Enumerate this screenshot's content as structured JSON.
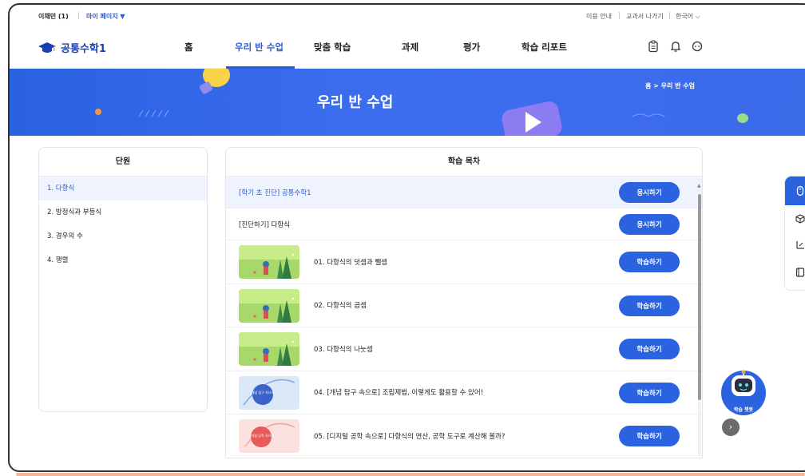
{
  "topbar": {
    "user": "이채민 (1)",
    "mypage": "마이 페이지 ▼",
    "guide": "이용 안내",
    "textbook_exit": "교과서 나가기",
    "language": "한국어 ⌵"
  },
  "nav": {
    "logo_text": "공통수학1",
    "items": [
      "홈",
      "우리 반 수업",
      "맞춤 학습",
      "과제",
      "평가",
      "학습 리포트"
    ],
    "active_index": 1
  },
  "hero": {
    "title": "우리 반 수업",
    "breadcrumb": "홈 > 우리 반 수업"
  },
  "units": {
    "header": "단원",
    "items": [
      "1. 다항식",
      "2. 방정식과 부등식",
      "3. 경우의 수",
      "4. 행렬"
    ],
    "active_index": 0
  },
  "toc": {
    "header": "학습 목차",
    "rows": [
      {
        "title": "[학기 초 진단] 공통수학1",
        "button": "응시하기"
      },
      {
        "title": "[진단하기] 다항식",
        "button": "응시하기"
      },
      {
        "title": "01. 다항식의 덧셈과 뺄셈",
        "button": "학습하기",
        "thumb": "farm"
      },
      {
        "title": "02. 다항식의 곱셈",
        "button": "학습하기",
        "thumb": "farm"
      },
      {
        "title": "03. 다항식의 나눗셈",
        "button": "학습하기",
        "thumb": "farm"
      },
      {
        "title": "04. [개념 탐구 속으로] 조립제법, 이렇게도 활용할 수 있어!",
        "button": "학습하기",
        "thumb": "concept",
        "thumb_text": "개념 탐구 속으로"
      },
      {
        "title": "05. [디지털 공학 속으로] 다항식의 연산, 공학 도구로 계산해 볼까?",
        "button": "학습하기",
        "thumb": "digital",
        "thumb_text": "디지털 공학 속으로"
      }
    ]
  },
  "chatbot": {
    "label": "학습 챗봇"
  },
  "colors": {
    "primary": "#2a62e0",
    "active_text": "#2a5bd7",
    "highlight_bg": "#eef3fd"
  }
}
